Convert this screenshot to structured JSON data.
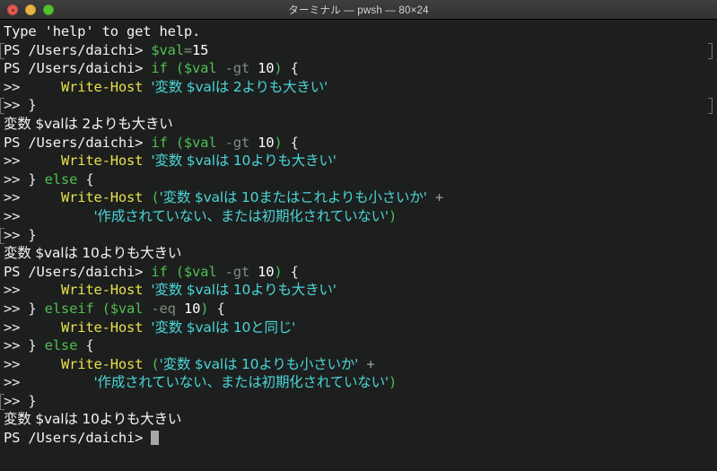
{
  "window": {
    "title": "ターミナル — pwsh — 80×24",
    "traffic_lights": [
      {
        "name": "close-button",
        "color": "#e25b51"
      },
      {
        "name": "minimize-button",
        "color": "#e9b644"
      },
      {
        "name": "maximize-button",
        "color": "#52c22f"
      }
    ],
    "background": "#1d1f1e",
    "cols": 80,
    "rows": 24
  },
  "theme": {
    "foreground": "#e9e9e9",
    "keyword": "#4fbf52",
    "variable": "#4fbf52",
    "operator": "#7e8c7e",
    "number": "#ffffff",
    "command": "#e7e04a",
    "string": "#49d6d6",
    "output": "#f4f4f4",
    "cursor": "#a7a7a7"
  },
  "terminal": {
    "prompt": "PS /Users/daichi>",
    "continuation": ">>",
    "cursor_char": "█",
    "lines": [
      {
        "id": "l01",
        "marked": false,
        "marked_right": false,
        "text": "Type 'help' to get help."
      },
      {
        "id": "l02",
        "marked": true,
        "marked_right": true,
        "text": "PS /Users/daichi> $val=15"
      },
      {
        "id": "l03",
        "marked": false,
        "marked_right": false,
        "text": "PS /Users/daichi> if ($val -gt 10) {"
      },
      {
        "id": "l04",
        "marked": false,
        "marked_right": false,
        "text": ">>     Write-Host '変数 $valは 2よりも大きい'"
      },
      {
        "id": "l05",
        "marked": true,
        "marked_right": true,
        "text": ">> }"
      },
      {
        "id": "l06",
        "marked": false,
        "marked_right": false,
        "text": "変数 $valは 2よりも大きい"
      },
      {
        "id": "l07",
        "marked": false,
        "marked_right": false,
        "text": "PS /Users/daichi> if ($val -gt 10) {"
      },
      {
        "id": "l08",
        "marked": false,
        "marked_right": false,
        "text": ">>     Write-Host '変数 $valは 10よりも大きい'"
      },
      {
        "id": "l09",
        "marked": false,
        "marked_right": false,
        "text": ">> } else {"
      },
      {
        "id": "l10",
        "marked": false,
        "marked_right": false,
        "text": ">>     Write-Host ('変数 $valは 10またはこれよりも小さいか' +"
      },
      {
        "id": "l11",
        "marked": false,
        "marked_right": false,
        "text": ">>         '作成されていない、または初期化されていない')"
      },
      {
        "id": "l12",
        "marked": true,
        "marked_right": false,
        "text": ">> }"
      },
      {
        "id": "l13",
        "marked": false,
        "marked_right": false,
        "text": "変数 $valは 10よりも大きい"
      },
      {
        "id": "l14",
        "marked": false,
        "marked_right": false,
        "text": "PS /Users/daichi> if ($val -gt 10) {"
      },
      {
        "id": "l15",
        "marked": false,
        "marked_right": false,
        "text": ">>     Write-Host '変数 $valは 10よりも大きい'"
      },
      {
        "id": "l16",
        "marked": false,
        "marked_right": false,
        "text": ">> } elseif ($val -eq 10) {"
      },
      {
        "id": "l17",
        "marked": false,
        "marked_right": false,
        "text": ">>     Write-Host '変数 $valは 10と同じ'"
      },
      {
        "id": "l18",
        "marked": false,
        "marked_right": false,
        "text": ">> } else {"
      },
      {
        "id": "l19",
        "marked": false,
        "marked_right": false,
        "text": ">>     Write-Host ('変数 $valは 10よりも小さいか' +"
      },
      {
        "id": "l20",
        "marked": false,
        "marked_right": false,
        "text": ">>         '作成されていない、または初期化されていない')"
      },
      {
        "id": "l21",
        "marked": true,
        "marked_right": false,
        "text": ">> }"
      },
      {
        "id": "l22",
        "marked": false,
        "marked_right": false,
        "text": "変数 $valは 10よりも大きい"
      },
      {
        "id": "l23",
        "marked": false,
        "marked_right": false,
        "text": "PS /Users/daichi> "
      }
    ],
    "tokens": {
      "l01": [
        {
          "c": "t-out",
          "t": "Type 'help' to get help."
        }
      ],
      "l02": [
        {
          "c": "t-prompt",
          "t": "PS /Users/daichi> "
        },
        {
          "c": "t-var",
          "t": "$val"
        },
        {
          "c": "t-op",
          "t": "="
        },
        {
          "c": "t-num",
          "t": "15"
        }
      ],
      "l03": [
        {
          "c": "t-prompt",
          "t": "PS /Users/daichi> "
        },
        {
          "c": "t-kw",
          "t": "if"
        },
        {
          "c": "t-default",
          "t": " "
        },
        {
          "c": "t-paren",
          "t": "("
        },
        {
          "c": "t-var",
          "t": "$val"
        },
        {
          "c": "t-default",
          "t": " "
        },
        {
          "c": "t-op",
          "t": "-gt"
        },
        {
          "c": "t-default",
          "t": " "
        },
        {
          "c": "t-num",
          "t": "10"
        },
        {
          "c": "t-paren",
          "t": ")"
        },
        {
          "c": "t-default",
          "t": " {"
        }
      ],
      "l04": [
        {
          "c": "t-cont",
          "t": ">>     "
        },
        {
          "c": "t-cmd",
          "t": "Write-Host"
        },
        {
          "c": "t-default",
          "t": " "
        },
        {
          "c": "t-str cjk",
          "t": "'変数 $valは 2よりも大きい'"
        }
      ],
      "l05": [
        {
          "c": "t-cont",
          "t": ">> "
        },
        {
          "c": "t-default",
          "t": "}"
        }
      ],
      "l06": [
        {
          "c": "t-out cjk",
          "t": "変数 $valは 2よりも大きい"
        }
      ],
      "l07": [
        {
          "c": "t-prompt",
          "t": "PS /Users/daichi> "
        },
        {
          "c": "t-kw",
          "t": "if"
        },
        {
          "c": "t-default",
          "t": " "
        },
        {
          "c": "t-paren",
          "t": "("
        },
        {
          "c": "t-var",
          "t": "$val"
        },
        {
          "c": "t-default",
          "t": " "
        },
        {
          "c": "t-op",
          "t": "-gt"
        },
        {
          "c": "t-default",
          "t": " "
        },
        {
          "c": "t-num",
          "t": "10"
        },
        {
          "c": "t-paren",
          "t": ")"
        },
        {
          "c": "t-default",
          "t": " {"
        }
      ],
      "l08": [
        {
          "c": "t-cont",
          "t": ">>     "
        },
        {
          "c": "t-cmd",
          "t": "Write-Host"
        },
        {
          "c": "t-default",
          "t": " "
        },
        {
          "c": "t-str cjk",
          "t": "'変数 $valは 10よりも大きい'"
        }
      ],
      "l09": [
        {
          "c": "t-cont",
          "t": ">> "
        },
        {
          "c": "t-default",
          "t": "} "
        },
        {
          "c": "t-kw",
          "t": "else"
        },
        {
          "c": "t-default",
          "t": " {"
        }
      ],
      "l10": [
        {
          "c": "t-cont",
          "t": ">>     "
        },
        {
          "c": "t-cmd",
          "t": "Write-Host"
        },
        {
          "c": "t-default",
          "t": " "
        },
        {
          "c": "t-paren",
          "t": "("
        },
        {
          "c": "t-str cjk",
          "t": "'変数 $valは 10またはこれよりも小さいか'"
        },
        {
          "c": "t-default",
          "t": " "
        },
        {
          "c": "t-plus",
          "t": "+"
        }
      ],
      "l11": [
        {
          "c": "t-cont",
          "t": ">>         "
        },
        {
          "c": "t-str cjk",
          "t": "'作成されていない、または初期化されていない'"
        },
        {
          "c": "t-paren",
          "t": ")"
        }
      ],
      "l12": [
        {
          "c": "t-cont",
          "t": ">> "
        },
        {
          "c": "t-default",
          "t": "}"
        }
      ],
      "l13": [
        {
          "c": "t-out cjk",
          "t": "変数 $valは 10よりも大きい"
        }
      ],
      "l14": [
        {
          "c": "t-prompt",
          "t": "PS /Users/daichi> "
        },
        {
          "c": "t-kw",
          "t": "if"
        },
        {
          "c": "t-default",
          "t": " "
        },
        {
          "c": "t-paren",
          "t": "("
        },
        {
          "c": "t-var",
          "t": "$val"
        },
        {
          "c": "t-default",
          "t": " "
        },
        {
          "c": "t-op",
          "t": "-gt"
        },
        {
          "c": "t-default",
          "t": " "
        },
        {
          "c": "t-num",
          "t": "10"
        },
        {
          "c": "t-paren",
          "t": ")"
        },
        {
          "c": "t-default",
          "t": " {"
        }
      ],
      "l15": [
        {
          "c": "t-cont",
          "t": ">>     "
        },
        {
          "c": "t-cmd",
          "t": "Write-Host"
        },
        {
          "c": "t-default",
          "t": " "
        },
        {
          "c": "t-str cjk",
          "t": "'変数 $valは 10よりも大きい'"
        }
      ],
      "l16": [
        {
          "c": "t-cont",
          "t": ">> "
        },
        {
          "c": "t-default",
          "t": "} "
        },
        {
          "c": "t-kw",
          "t": "elseif"
        },
        {
          "c": "t-default",
          "t": " "
        },
        {
          "c": "t-paren",
          "t": "("
        },
        {
          "c": "t-var",
          "t": "$val"
        },
        {
          "c": "t-default",
          "t": " "
        },
        {
          "c": "t-op",
          "t": "-eq"
        },
        {
          "c": "t-default",
          "t": " "
        },
        {
          "c": "t-num",
          "t": "10"
        },
        {
          "c": "t-paren",
          "t": ")"
        },
        {
          "c": "t-default",
          "t": " {"
        }
      ],
      "l17": [
        {
          "c": "t-cont",
          "t": ">>     "
        },
        {
          "c": "t-cmd",
          "t": "Write-Host"
        },
        {
          "c": "t-default",
          "t": " "
        },
        {
          "c": "t-str cjk",
          "t": "'変数 $valは 10と同じ'"
        }
      ],
      "l18": [
        {
          "c": "t-cont",
          "t": ">> "
        },
        {
          "c": "t-default",
          "t": "} "
        },
        {
          "c": "t-kw",
          "t": "else"
        },
        {
          "c": "t-default",
          "t": " {"
        }
      ],
      "l19": [
        {
          "c": "t-cont",
          "t": ">>     "
        },
        {
          "c": "t-cmd",
          "t": "Write-Host"
        },
        {
          "c": "t-default",
          "t": " "
        },
        {
          "c": "t-paren",
          "t": "("
        },
        {
          "c": "t-str cjk",
          "t": "'変数 $valは 10よりも小さいか'"
        },
        {
          "c": "t-default",
          "t": " "
        },
        {
          "c": "t-plus",
          "t": "+"
        }
      ],
      "l20": [
        {
          "c": "t-cont",
          "t": ">>         "
        },
        {
          "c": "t-str cjk",
          "t": "'作成されていない、または初期化されていない'"
        },
        {
          "c": "t-paren",
          "t": ")"
        }
      ],
      "l21": [
        {
          "c": "t-cont",
          "t": ">> "
        },
        {
          "c": "t-default",
          "t": "}"
        }
      ],
      "l22": [
        {
          "c": "t-out cjk",
          "t": "変数 $valは 10よりも大きい"
        }
      ],
      "l23": [
        {
          "c": "t-prompt",
          "t": "PS /Users/daichi> "
        },
        {
          "c": "cursor-slot",
          "t": ""
        }
      ]
    }
  }
}
